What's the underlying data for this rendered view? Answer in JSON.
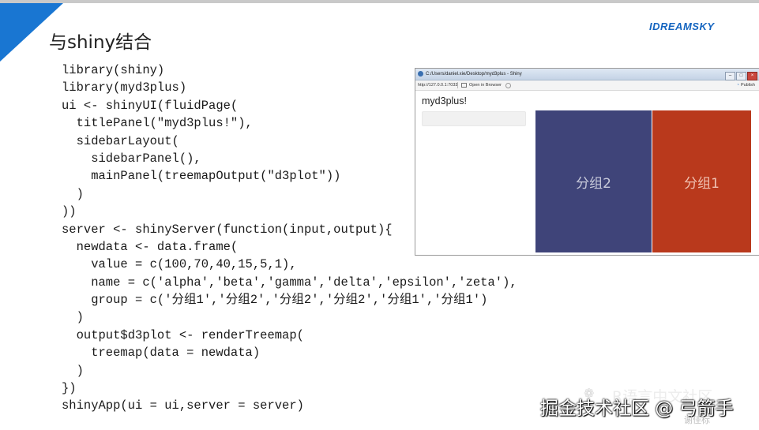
{
  "slide": {
    "title": "与shiny结合",
    "logo_text": "IDREAMSKY",
    "accent_color": "#1976d2"
  },
  "code_lines": [
    "library(shiny)",
    "library(myd3plus)",
    "ui <- shinyUI(fluidPage(",
    "  titlePanel(\"myd3plus!\"),",
    "  sidebarLayout(",
    "    sidebarPanel(),",
    "    mainPanel(treemapOutput(\"d3plot\"))",
    "  )",
    "))",
    "server <- shinyServer(function(input,output){",
    "  newdata <- data.frame(",
    "    value = c(100,70,40,15,5,1),",
    "    name = c('alpha','beta','gamma','delta','epsilon','zeta'),",
    "    group = c('分组1','分组2','分组2','分组2','分组1','分组1')",
    "  )",
    "  output$d3plot <- renderTreemap(",
    "    treemap(data = newdata)",
    "  )",
    "})",
    "shinyApp(ui = ui,server = server)"
  ],
  "screenshot": {
    "window_title": "C:/Users/daniel.xie/Desktop/myd3plus - Shiny",
    "window_controls": [
      "–",
      "□",
      "×"
    ],
    "url": "http://127.0.0.1:7033",
    "open_in_browser_label": "Open in Browser",
    "publish_label": "Publish",
    "app_title": "myd3plus!",
    "treemap": {
      "tiles": [
        {
          "label": "分组2",
          "color": "#3f4479"
        },
        {
          "label": "分组1",
          "color": "#b9391c"
        }
      ]
    }
  },
  "watermark": {
    "main": "掘金技术社区 @ 弓箭手",
    "overlay": "R语言中文社区",
    "under": "谢佳标"
  }
}
